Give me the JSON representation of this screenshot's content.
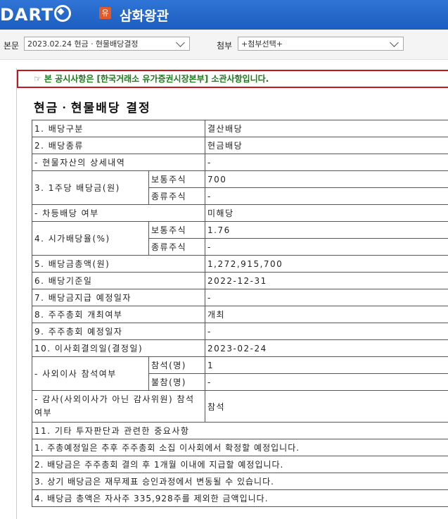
{
  "header": {
    "logo_text": "DART",
    "badge": "유",
    "company": "삼화왕관"
  },
  "toolbar": {
    "main_label": "본문",
    "main_select": "2023.02.24  현금ㆍ현물배당결정",
    "attach_label": "첨부",
    "attach_select": "+첨부선택+"
  },
  "notice": "☞ 본 공시사항은 [한국거래소 유가증권시장본부] 소관사항입니다.",
  "doc_title": "현금ㆍ현물배당 결정",
  "rows": {
    "r1_label": "1. 배당구분",
    "r1_value": "결산배당",
    "r2_label": "2. 배당종류",
    "r2_value": "현금배당",
    "r3_label": "- 현물자산의 상세내역",
    "r3_value": "-",
    "r4_label": "3. 1주당 배당금(원)",
    "r4_sub1": "보통주식",
    "r4_val1": "700",
    "r4_sub2": "종류주식",
    "r4_val2": "-",
    "r5_label": "- 차등배당 여부",
    "r5_value": "미해당",
    "r6_label": "4. 시가배당율(%)",
    "r6_sub1": "보통주식",
    "r6_val1": "1.76",
    "r6_sub2": "종류주식",
    "r6_val2": "-",
    "r7_label": "5. 배당금총액(원)",
    "r7_value": "1,272,915,700",
    "r8_label": "6. 배당기준일",
    "r8_value": "2022-12-31",
    "r9_label": "7. 배당금지급 예정일자",
    "r9_value": "-",
    "r10_label": "8. 주주총회 개최여부",
    "r10_value": "개최",
    "r11_label": "9. 주주총회 예정일자",
    "r11_value": "-",
    "r12_label": "10. 이사회결의일(결정일)",
    "r12_value": "2023-02-24",
    "r13_label": "- 사외이사 참석여부",
    "r13_sub1": "참석(명)",
    "r13_val1": "1",
    "r13_sub2": "불참(명)",
    "r13_val2": "-",
    "r14_label": "- 감사(사외이사가 아닌 감사위원) 참석여부",
    "r14_value": "참석",
    "r15_label": "11. 기타 투자판단과 관련한 중요사항",
    "notes": [
      "1. 주총예정일은 추후 주주총회 소집 이사회에서 확정할 예정입니다.",
      "2. 배당금은 주주총회 결의 후 1개월 이내에 지급할 예정입니다.",
      "3. 상기 배당금은 재무제표 승인과정에서 변동될 수 있습니다.",
      "4. 배당금 총액은 자사주 335,928주를 제외한 금액입니다."
    ]
  }
}
